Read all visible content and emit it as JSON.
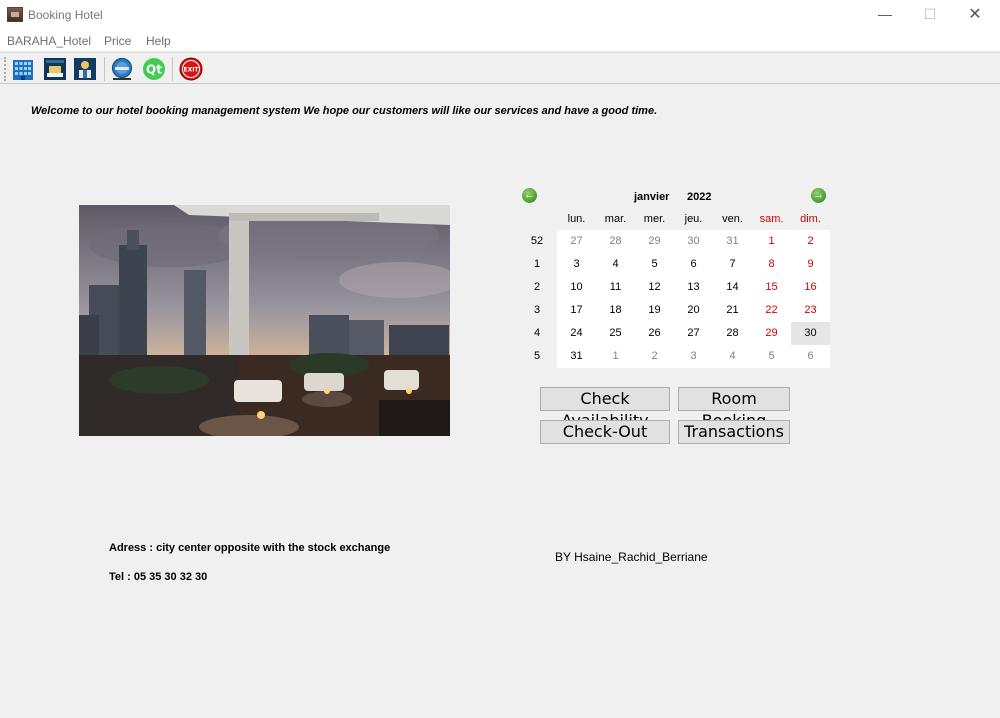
{
  "window": {
    "title": "Booking Hotel",
    "minimize": "—",
    "maximize": "☐",
    "close": "✕"
  },
  "menu": {
    "items": [
      "BARAHA_Hotel",
      "Price",
      "Help"
    ]
  },
  "toolbar": {
    "buttons": [
      {
        "icon": "hotel-building-icon"
      },
      {
        "icon": "room-icon"
      },
      {
        "icon": "guest-icon"
      },
      {
        "icon": "app-icon"
      },
      {
        "icon": "qt-icon",
        "label": "Qt"
      },
      {
        "icon": "exit-icon",
        "label": "EXIT"
      }
    ]
  },
  "welcome": "Welcome to our hotel booking management system We hope our customers will like our services and have a good time.",
  "calendar": {
    "month": "janvier",
    "year": "2022",
    "prev_arrow": "←",
    "next_arrow": "→",
    "weekdays": [
      "lun.",
      "mar.",
      "mer.",
      "jeu.",
      "ven.",
      "sam.",
      "dim."
    ],
    "weeks": [
      {
        "num": "52",
        "days": [
          "27",
          "28",
          "29",
          "30",
          "31",
          "1",
          "2"
        ]
      },
      {
        "num": "1",
        "days": [
          "3",
          "4",
          "5",
          "6",
          "7",
          "8",
          "9"
        ]
      },
      {
        "num": "2",
        "days": [
          "10",
          "11",
          "12",
          "13",
          "14",
          "15",
          "16"
        ]
      },
      {
        "num": "3",
        "days": [
          "17",
          "18",
          "19",
          "20",
          "21",
          "22",
          "23"
        ]
      },
      {
        "num": "4",
        "days": [
          "24",
          "25",
          "26",
          "27",
          "28",
          "29",
          "30"
        ]
      },
      {
        "num": "5",
        "days": [
          "31",
          "1",
          "2",
          "3",
          "4",
          "5",
          "6"
        ]
      }
    ],
    "selected_day": "30",
    "colors": {
      "weekend": "#d40000",
      "other_month": "#808080",
      "nav_arrow": "#3c8c23"
    }
  },
  "buttons": {
    "check_availability": "Check Availability",
    "room_booking": "Room Booking",
    "check_out": "Check-Out",
    "transactions": "Transactions"
  },
  "footer": {
    "address": "Adress : city center opposite with the stock exchange",
    "tel": "Tel : 05 35 30 32 30",
    "author": "BY Hsaine_Rachid_Berriane"
  }
}
